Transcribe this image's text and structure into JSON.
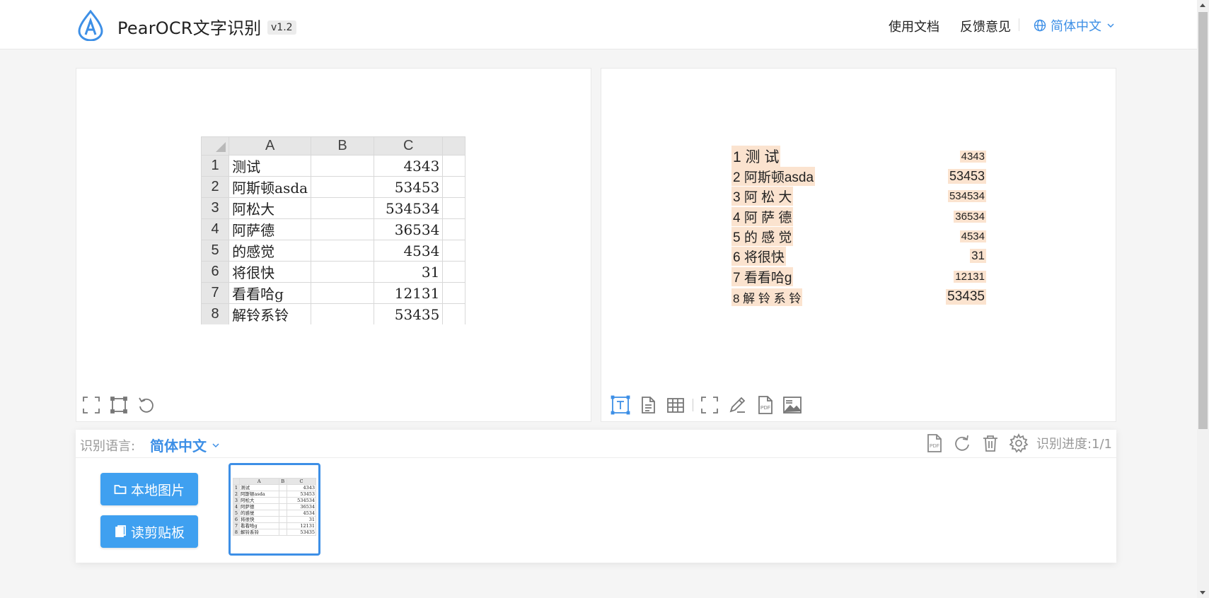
{
  "header": {
    "app_name": "PearOCR文字识别",
    "version": "v1.2",
    "nav": {
      "docs": "使用文档",
      "feedback": "反馈意见",
      "language": "简体中文"
    }
  },
  "sheet": {
    "columns": [
      "A",
      "B",
      "C"
    ],
    "rows": [
      {
        "num": "1",
        "a": "测试",
        "c": "4343"
      },
      {
        "num": "2",
        "a": "阿斯顿asda",
        "c": "53453"
      },
      {
        "num": "3",
        "a": "阿松大",
        "c": "534534"
      },
      {
        "num": "4",
        "a": "阿萨德",
        "c": "36534"
      },
      {
        "num": "5",
        "a": "的感觉",
        "c": "4534"
      },
      {
        "num": "6",
        "a": "将很快",
        "c": "31"
      },
      {
        "num": "7",
        "a": "看看哈g",
        "c": "12131"
      },
      {
        "num": "8",
        "a": "解铃系铃",
        "c": "53435"
      },
      {
        "num": "9",
        "a": "",
        "c": ""
      }
    ]
  },
  "ocr_result": {
    "lines": [
      {
        "left": "1 测 试",
        "right": "4343"
      },
      {
        "left": "2 阿斯顿asda",
        "right": "53453"
      },
      {
        "left": "3 阿 松 大",
        "right": "534534"
      },
      {
        "left": "4 阿 萨 德",
        "right": "36534"
      },
      {
        "left": "5 的 感 觉",
        "right": "4534"
      },
      {
        "left": "6 将很快",
        "right": "31"
      },
      {
        "left": "7 看看哈g",
        "right": "12131"
      },
      {
        "left": "8 解 铃 系 铃",
        "right": "53435"
      }
    ]
  },
  "bottom": {
    "lang_label": "识别语言:",
    "lang_value": "简体中文",
    "progress": "识别进度:1/1",
    "local_image_button": "本地图片",
    "clipboard_button": "读剪贴板"
  },
  "colors": {
    "accent": "#3d8fe6",
    "button": "#3fa0f0",
    "highlight": "#fbe3cf"
  }
}
